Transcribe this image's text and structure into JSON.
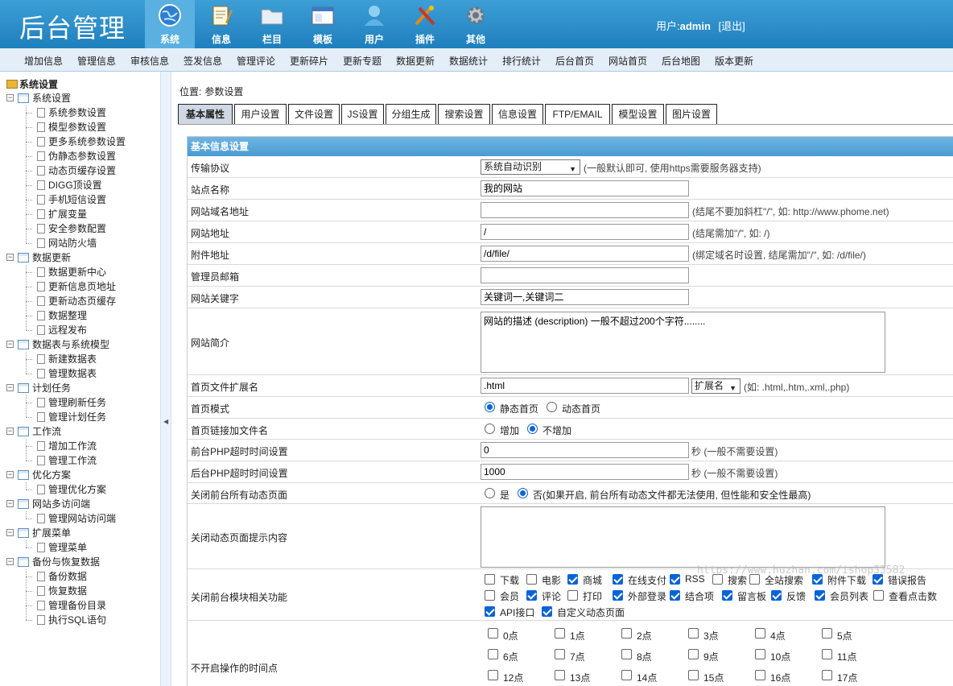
{
  "app": {
    "title": "后台管理",
    "user_label": "用户:",
    "user_name": "admin",
    "logout": "[退出]",
    "accent": "#2a8ac9"
  },
  "topnav": [
    {
      "label": "系统",
      "icon": "globe-icon"
    },
    {
      "label": "信息",
      "icon": "notepad-icon"
    },
    {
      "label": "栏目",
      "icon": "folder-icon"
    },
    {
      "label": "模板",
      "icon": "window-icon"
    },
    {
      "label": "用户",
      "icon": "user-icon"
    },
    {
      "label": "插件",
      "icon": "tools-icon"
    },
    {
      "label": "其他",
      "icon": "gear-icon"
    }
  ],
  "submenu": [
    "增加信息",
    "管理信息",
    "审核信息",
    "签发信息",
    "管理评论",
    "更新碎片",
    "更新专题",
    "数据更新",
    "数据统计",
    "排行统计",
    "后台首页",
    "网站首页",
    "后台地图",
    "版本更新"
  ],
  "sidebar": {
    "root": "系统设置",
    "groups": [
      {
        "label": "系统设置",
        "items": [
          "系统参数设置",
          "模型参数设置",
          "更多系统参数设置",
          "伪静态参数设置",
          "动态页缓存设置",
          "DIGG顶设置",
          "手机短信设置",
          "扩展变量",
          "安全参数配置",
          "网站防火墙"
        ]
      },
      {
        "label": "数据更新",
        "items": [
          "数据更新中心",
          "更新信息页地址",
          "更新动态页缓存",
          "数据整理",
          "远程发布"
        ]
      },
      {
        "label": "数据表与系统模型",
        "items": [
          "新建数据表",
          "管理数据表"
        ]
      },
      {
        "label": "计划任务",
        "items": [
          "管理刷新任务",
          "管理计划任务"
        ]
      },
      {
        "label": "工作流",
        "items": [
          "增加工作流",
          "管理工作流"
        ]
      },
      {
        "label": "优化方案",
        "items": [
          "管理优化方案"
        ]
      },
      {
        "label": "网站多访问端",
        "items": [
          "管理网站访问端"
        ]
      },
      {
        "label": "扩展菜单",
        "items": [
          "管理菜单"
        ]
      },
      {
        "label": "备份与恢复数据",
        "items": [
          "备份数据",
          "恢复数据",
          "管理备份目录",
          "执行SQL语句"
        ]
      }
    ]
  },
  "main": {
    "position_label": "位置:",
    "position_value": "参数设置",
    "tabs": [
      "基本属性",
      "用户设置",
      "文件设置",
      "JS设置",
      "分组生成",
      "搜索设置",
      "信息设置",
      "FTP/EMAIL",
      "模型设置",
      "图片设置"
    ],
    "panel_title": "基本信息设置",
    "form": {
      "protocol": {
        "label": "传输协议",
        "value": "系统自动识别",
        "note": "(一般默认即可, 使用https需要服务器支持)"
      },
      "sitename": {
        "label": "站点名称",
        "value": "我的网站"
      },
      "domain": {
        "label": "网站域名地址",
        "value": "",
        "note": "(结尾不要加斜杠\"/\", 如: http://www.phome.net)"
      },
      "siteurl": {
        "label": "网站地址",
        "value": "/",
        "note": "(结尾需加\"/\", 如: /)"
      },
      "fileurl": {
        "label": "附件地址",
        "value": "/d/file/",
        "note": "(绑定域名时设置, 结尾需加\"/\", 如: /d/file/)"
      },
      "email": {
        "label": "管理员邮箱",
        "value": ""
      },
      "keywords": {
        "label": "网站关键字",
        "value": "关键词一,关键词二"
      },
      "intro": {
        "label": "网站简介",
        "value": "网站的描述 (description) 一般不超过200个字符........"
      },
      "ext": {
        "label": "首页文件扩展名",
        "value": ".html",
        "select": "扩展名",
        "note": "(如: .html,.htm,.xml,.php)"
      },
      "mode": {
        "label": "首页模式",
        "opt1": "静态首页",
        "opt2": "动态首页"
      },
      "linkfile": {
        "label": "首页链接加文件名",
        "opt1": "增加",
        "opt2": "不增加"
      },
      "phptime_front": {
        "label": "前台PHP超时时间设置",
        "value": "0",
        "note": "秒 (一般不需要设置)"
      },
      "phptime_back": {
        "label": "后台PHP超时时间设置",
        "value": "1000",
        "note": "秒 (一般不需要设置)"
      },
      "closedyn": {
        "label": "关闭前台所有动态页面",
        "opt1": "是",
        "opt2": "否(如果开启, 前台所有动态文件都无法使用, 但性能和安全性最高)"
      },
      "closemsg": {
        "label": "关闭动态页面提示内容",
        "value": ""
      },
      "closemod": {
        "label": "关闭前台模块相关功能",
        "items": [
          {
            "label": "下载",
            "checked": false
          },
          {
            "label": "电影",
            "checked": false
          },
          {
            "label": "商城",
            "checked": true
          },
          {
            "label": "在线支付",
            "checked": true
          },
          {
            "label": "RSS",
            "checked": true
          },
          {
            "label": "搜索",
            "checked": false
          },
          {
            "label": "全站搜索",
            "checked": false
          },
          {
            "label": "附件下载",
            "checked": true
          },
          {
            "label": "错误报告",
            "checked": true
          },
          {
            "label": "会员",
            "checked": false
          },
          {
            "label": "评论",
            "checked": true
          },
          {
            "label": "打印",
            "checked": false
          },
          {
            "label": "外部登录",
            "checked": true
          },
          {
            "label": "结合项",
            "checked": true
          },
          {
            "label": "留言板",
            "checked": true
          },
          {
            "label": "反馈",
            "checked": true
          },
          {
            "label": "会员列表",
            "checked": true
          },
          {
            "label": "查看点击数",
            "checked": false
          },
          {
            "label": "API接口",
            "checked": true
          },
          {
            "label": "自定义动态页面",
            "checked": true
          }
        ]
      },
      "closehours": {
        "label": "不开启操作的时间点",
        "hours": [
          "0点",
          "1点",
          "2点",
          "3点",
          "4点",
          "5点",
          "6点",
          "7点",
          "8点",
          "9点",
          "10点",
          "11点",
          "12点",
          "13点",
          "14点",
          "15点",
          "16点",
          "17点"
        ]
      }
    }
  },
  "watermark": "https://www.huzhan.com/ishop33582"
}
